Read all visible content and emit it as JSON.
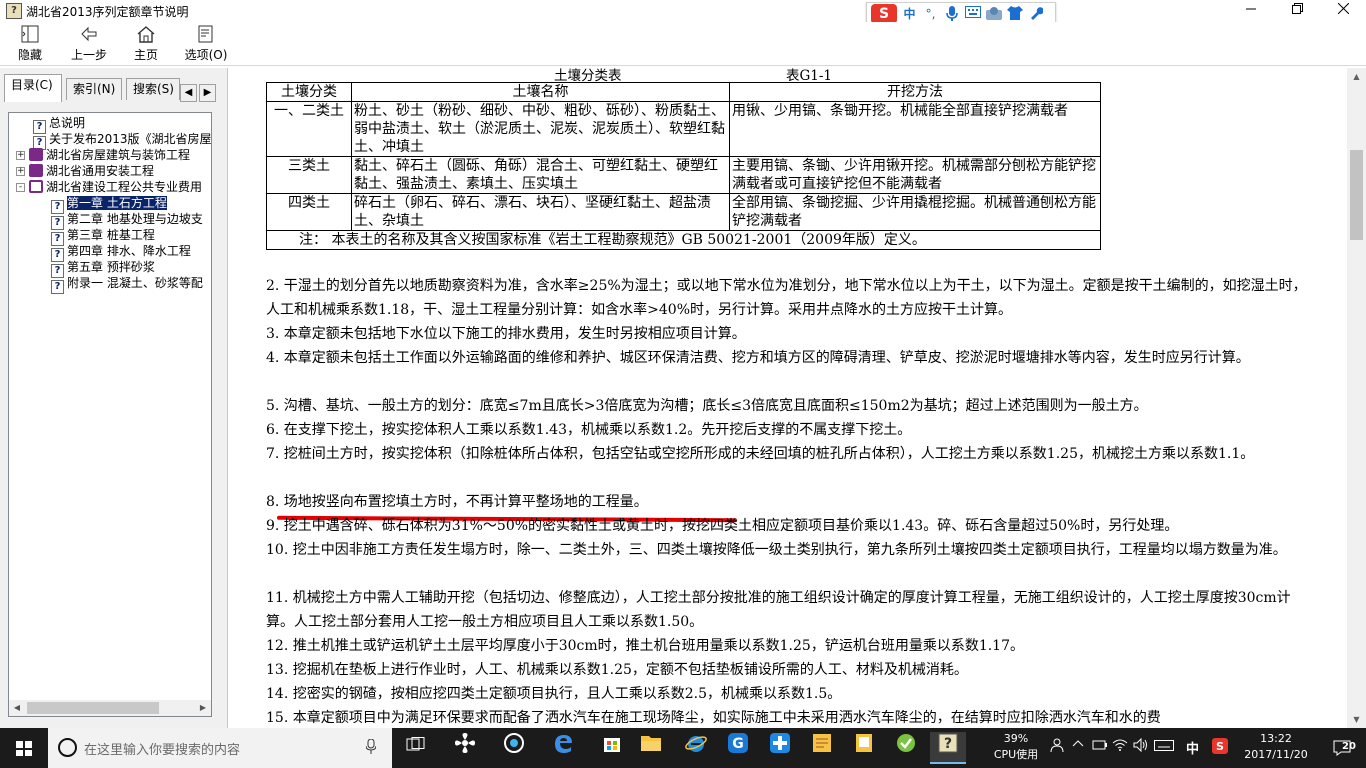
{
  "window": {
    "title": "湖北省2013序列定额章节说明"
  },
  "ime": {
    "logo": "S",
    "mode": "中",
    "punct": "°,",
    "icons": [
      "microphone-icon",
      "keyboard-icon",
      "skin-icon",
      "shirt-icon",
      "wrench-icon"
    ]
  },
  "toolbar": {
    "buttons": [
      {
        "label": "隐藏",
        "icon": "hide-icon"
      },
      {
        "label": "上一步",
        "icon": "back-arrow-icon"
      },
      {
        "label": "主页",
        "icon": "home-icon"
      },
      {
        "label": "选项(O)",
        "icon": "options-icon"
      }
    ]
  },
  "leftpane": {
    "tabs": [
      "目录(C)",
      "索引(N)",
      "搜索(S)"
    ],
    "tree": [
      {
        "label": "总说明",
        "type": "page",
        "level": 1
      },
      {
        "label": "关于发布2013版《湖北省房屋",
        "type": "page",
        "level": 1
      },
      {
        "label": "湖北省房屋建筑与装饰工程",
        "type": "book",
        "level": 0,
        "expand": "+"
      },
      {
        "label": "湖北省通用安装工程",
        "type": "book",
        "level": 0,
        "expand": "+"
      },
      {
        "label": "湖北省建设工程公共专业费用",
        "type": "book-open",
        "level": 0,
        "expand": "-"
      },
      {
        "label": "第一章 土石方工程",
        "type": "page",
        "level": 2,
        "selected": true
      },
      {
        "label": "第二章 地基处理与边坡支",
        "type": "page",
        "level": 2
      },
      {
        "label": "第三章 桩基工程",
        "type": "page",
        "level": 2
      },
      {
        "label": "第四章 排水、降水工程",
        "type": "page",
        "level": 2
      },
      {
        "label": "第五章 预拌砂浆",
        "type": "page",
        "level": 2
      },
      {
        "label": "附录一 混凝土、砂浆等配",
        "type": "page",
        "level": 2
      }
    ]
  },
  "content": {
    "table_title": "土壤分类表",
    "table_code": "表G1-1",
    "table_headers": [
      "土壤分类",
      "土壤名称",
      "开挖方法"
    ],
    "table_rows": [
      [
        "一、二类土",
        "粉土、砂土（粉砂、细砂、中砂、粗砂、砾砂）、粉质黏土、弱中盐渍土、软土（淤泥质土、泥炭、泥炭质土）、软塑红黏土、冲填土",
        "用锹、少用镐、条锄开挖。机械能全部直接铲挖满载者"
      ],
      [
        "三类土",
        "黏土、碎石土（圆砾、角砾）混合土、可塑红黏土、硬塑红黏土、强盐渍土、素填土、压实填土",
        "主要用镐、条锄、少许用锹开挖。机械需部分刨松方能铲挖满载者或可直接铲挖但不能满载者"
      ],
      [
        "四类土",
        "碎石土（卵石、碎石、漂石、块石）、坚硬红黏土、超盐渍土、杂填土",
        "全部用镐、条锄挖掘、少许用撬棍挖掘。机械普通刨松方能铲挖满载者"
      ]
    ],
    "table_note": "注： 本表土的名称及其含义按国家标准《岩土工程勘察规范》GB 50021-2001（2009年版）定义。",
    "paragraphs": [
      "2. 干湿土的划分首先以地质勘察资料为准，含水率≥25%为湿土；或以地下常水位为准划分，地下常水位以上为干土，以下为湿土。定额是按干土编制的，如挖湿土时，人工和机械乘系数1.18，干、湿土工程量分别计算：如含水率>40%时，另行计算。采用井点降水的土方应按干土计算。",
      "3. 本章定额未包括地下水位以下施工的排水费用，发生时另按相应项目计算。",
      "4. 本章定额未包括土工作面以外运输路面的维修和养护、城区环保清洁费、挖方和填方区的障碍清理、铲草皮、挖淤泥时堰塘排水等内容，发生时应另行计算。",
      "5. 沟槽、基坑、一般土方的划分：底宽≤7m且底长>3倍底宽为沟槽；底长≤3倍底宽且底面积≤150m2为基坑；超过上述范围则为一般土方。",
      "6. 在支撑下挖土，按实挖体积人工乘以系数1.43，机械乘以系数1.2。先开挖后支撑的不属支撑下挖土。",
      "7. 挖桩间土方时，按实挖体积（扣除桩体所占体积，包括空钻或空挖所形成的未经回填的桩孔所占体积），人工挖土方乘以系数1.25，机械挖土方乘以系数1.1。",
      "8. 场地按竖向布置挖填土方时，不再计算平整场地的工程量。",
      "9. 挖土中遇含碎、砾石体积为31%～50%的密实黏性土或黄土时，按挖四类土相应定额项目基价乘以1.43。碎、砾石含量超过50%时，另行处理。",
      "10. 挖土中因非施工方责任发生塌方时，除一、二类土外，三、四类土壤按降低一级土类别执行，第九条所列土壤按四类土定额项目执行，工程量均以塌方数量为准。",
      "11. 机械挖土方中需人工辅助开挖（包括切边、修整底边），人工挖土部分按批准的施工组织设计确定的厚度计算工程量，无施工组织设计的，人工挖土厚度按30cm计算。人工挖土部分套用人工挖一般土方相应项目且人工乘以系数1.50。",
      "12. 推土机推土或铲运机铲土土层平均厚度小于30cm时，推土机台班用量乘以系数1.25，铲运机台班用量乘以系数1.17。",
      "13. 挖掘机在垫板上进行作业时，人工、机械乘以系数1.25，定额不包括垫板铺设所需的人工、材料及机械消耗。",
      "14. 挖密实的钢碴，按相应挖四类土定额项目执行，且人工乘以系数2.5，机械乘以系数1.5。",
      "15. 本章定额项目中为满足环保要求而配备了洒水汽车在施工现场降尘，如实际施工中未采用洒水汽车降尘的，在结算时应扣除洒水汽车和水的费"
    ],
    "highlight_color": "#e30000"
  },
  "taskbar": {
    "search_placeholder": "在这里输入你要搜索的内容",
    "apps": [
      "task-view-icon",
      "fan-app-icon",
      "network-app-icon",
      "edge-icon",
      "store-icon",
      "explorer-icon",
      "ie-icon",
      "g-app-icon",
      "plus-app-icon",
      "notes-app-icon",
      "tablet-app-icon",
      "green-app-icon",
      "help-app-icon"
    ],
    "cpu_value": "39%",
    "cpu_label": "CPU使用",
    "ime_lang": "中",
    "time": "13:22",
    "date": "2017/11/20",
    "notify_count": "20"
  }
}
